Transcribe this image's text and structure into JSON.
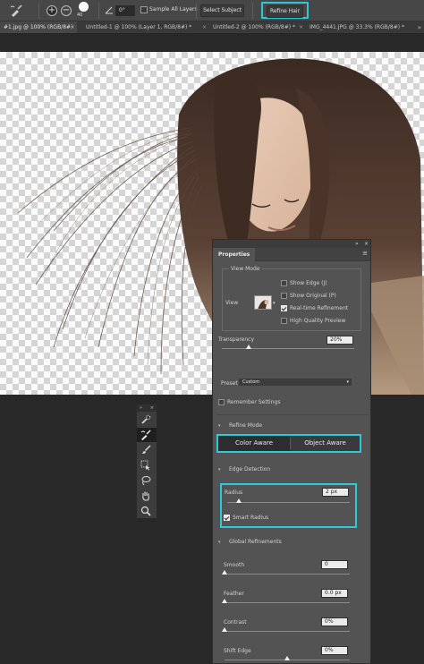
{
  "options_bar": {
    "brush_size": "40",
    "angle_value": "0°",
    "sample_all_layers_label": "Sample All Layers",
    "select_subject_label": "Select Subject",
    "refine_hair_label": "Refine Hair"
  },
  "tabs": [
    {
      "label": "#1.jpg @ 100% (RGB/8#)",
      "active": true
    },
    {
      "label": "Untitled-1 @ 100% (Layer 1, RGB/8#) *",
      "active": false
    },
    {
      "label": "Untitled-2 @ 100% (RGB/8#) *",
      "active": false
    },
    {
      "label": "IMG_4441.JPG @ 33.3% (RGB/8#) *",
      "active": false
    }
  ],
  "tabs_overflow": "»",
  "tools_panel": {
    "tools": [
      "quick-selection-icon",
      "refine-edge-brush-icon",
      "brush-icon",
      "object-selection-icon",
      "lasso-icon",
      "hand-icon",
      "zoom-icon"
    ],
    "active_index": 1
  },
  "properties": {
    "title": "Properties",
    "view_mode": {
      "title": "View Mode",
      "view_label": "View",
      "show_edge": {
        "label": "Show Edge (J)",
        "checked": false
      },
      "show_original": {
        "label": "Show Original (P)",
        "checked": false
      },
      "realtime_refinement": {
        "label": "Real-time Refinement",
        "checked": true
      },
      "high_quality_preview": {
        "label": "High Quality Preview",
        "checked": false
      }
    },
    "transparency": {
      "label": "Transparency",
      "value": "20%",
      "fraction": 0.2
    },
    "preset": {
      "label": "Preset",
      "value": "Custom"
    },
    "remember_settings": {
      "label": "Remember Settings",
      "checked": false
    },
    "refine_mode": {
      "title": "Refine Mode",
      "options": [
        "Color Aware",
        "Object Aware"
      ],
      "selected": "Color Aware"
    },
    "edge_detection": {
      "title": "Edge Detection",
      "radius": {
        "label": "Radius",
        "value": "2 px",
        "fraction": 0.05
      },
      "smart_radius": {
        "label": "Smart Radius",
        "checked": true
      }
    },
    "global_refinements": {
      "title": "Global Refinements",
      "smooth": {
        "label": "Smooth",
        "value": "0",
        "fraction": 0.0
      },
      "feather": {
        "label": "Feather",
        "value": "0.0 px",
        "fraction": 0.0
      },
      "contrast": {
        "label": "Contrast",
        "value": "0%",
        "fraction": 0.0
      },
      "shift_edge": {
        "label": "Shift Edge",
        "value": "0%",
        "fraction": 0.5
      }
    }
  },
  "colors": {
    "highlight": "#2ec8d6",
    "panel_bg": "#535353",
    "app_bg": "#282828"
  }
}
